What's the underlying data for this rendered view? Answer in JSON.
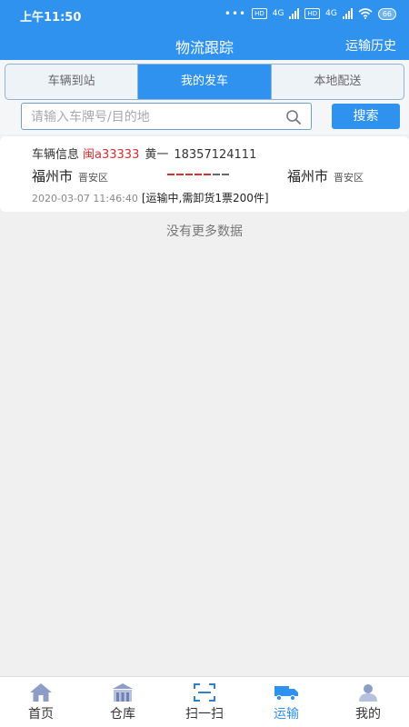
{
  "status_bar": {
    "time": "上午11:50",
    "network_1": "4G",
    "network_2": "4G",
    "hd_1": "HD",
    "hd_2": "HD",
    "battery": "66"
  },
  "navbar": {
    "title": "物流跟踪",
    "history_label": "运输历史"
  },
  "tabs": [
    {
      "label": "车辆到站",
      "active": false
    },
    {
      "label": "我的发车",
      "active": true
    },
    {
      "label": "本地配送",
      "active": false
    }
  ],
  "search": {
    "placeholder": "请输入车牌号/目的地",
    "value": "",
    "button_label": "搜索"
  },
  "shipments": [
    {
      "info_label": "车辆信息",
      "plate": "闽a33333",
      "driver": "黄一",
      "phone": "18357124111",
      "origin_city": "福州市",
      "origin_district": "晋安区",
      "dest_city": "福州市",
      "dest_district": "晋安区",
      "timestamp": "2020-03-07 11:46:40",
      "status": "[运输中,需卸货1票200件]"
    }
  ],
  "list_footer": "没有更多数据",
  "bottom_nav": [
    {
      "label": "首页",
      "icon": "home-icon",
      "active": false
    },
    {
      "label": "仓库",
      "icon": "warehouse-icon",
      "active": false
    },
    {
      "label": "扫一扫",
      "icon": "scan-icon",
      "active": false
    },
    {
      "label": "运输",
      "icon": "truck-icon",
      "active": true
    },
    {
      "label": "我的",
      "icon": "user-icon",
      "active": false
    }
  ],
  "colors": {
    "primary": "#2f92ef",
    "plate_red": "#d32f2f"
  }
}
